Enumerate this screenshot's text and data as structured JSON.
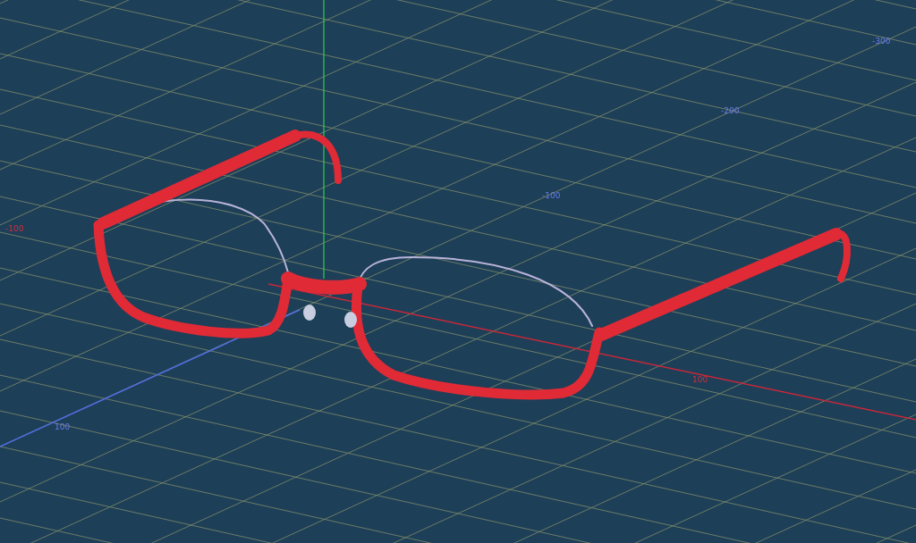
{
  "viewport": {
    "axis_labels": [
      {
        "text": "-300",
        "kind": "z"
      },
      {
        "text": "-200",
        "kind": "z"
      },
      {
        "text": "-100",
        "kind": "z"
      },
      {
        "text": "-100",
        "kind": "x"
      },
      {
        "text": "100",
        "kind": "x"
      },
      {
        "text": "100",
        "kind": "z"
      }
    ]
  }
}
